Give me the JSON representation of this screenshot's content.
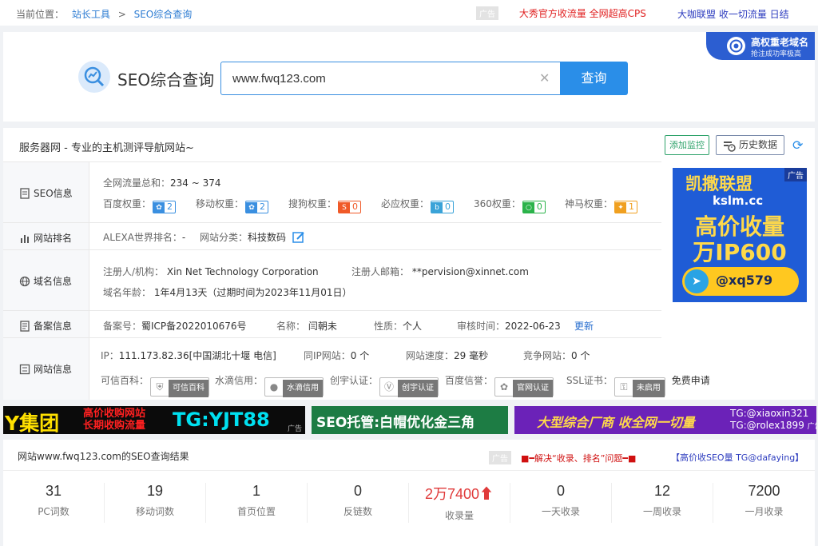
{
  "breadcrumb": {
    "prefix": "当前位置：",
    "home": "站长工具",
    "sep": ">",
    "current": "SEO综合查询"
  },
  "top_ads": {
    "ad_tag": "广告",
    "ad1": "大秀官方收流量 全网超高CPS",
    "ad2": "大咖联盟 收一切流量 日结"
  },
  "search": {
    "title": "SEO综合查询",
    "query": "www.fwq123.com",
    "button": "查询"
  },
  "corner_badge": {
    "line1": "高权重老域名",
    "line2": "抢注成功率极高"
  },
  "site": {
    "title": "服务器网 - 专业的主机测评导航网站~",
    "monitor_btn": "添加监控",
    "history_btn": "历史数据"
  },
  "seo_info": {
    "label": "SEO信息",
    "traffic_label": "全网流量总和：",
    "traffic_value": "234 ~ 374",
    "ranks": [
      {
        "label": "百度权重：",
        "value": "2",
        "color": "#3a8fe0",
        "icon": "paw-icon"
      },
      {
        "label": "移动权重：",
        "value": "2",
        "color": "#3a8fe0",
        "icon": "paw-icon"
      },
      {
        "label": "搜狗权重：",
        "value": "0",
        "color": "#f05a28",
        "icon": "sogou-icon"
      },
      {
        "label": "必应权重：",
        "value": "0",
        "color": "#3aa3d8",
        "icon": "bing-icon"
      },
      {
        "label": "360权重：",
        "value": "0",
        "color": "#2bb34a",
        "icon": "360-icon"
      },
      {
        "label": "神马权重：",
        "value": "1",
        "color": "#f0a020",
        "icon": "shenma-icon"
      }
    ]
  },
  "ranking": {
    "label": "网站排名",
    "alexa_label": "ALEXA世界排名：",
    "alexa_value": "-",
    "category_label": "网站分类：",
    "category_value": "科技数码"
  },
  "domain": {
    "label": "域名信息",
    "registrant_label": "注册人/机构：",
    "registrant_value": "Xin Net Technology Corporation",
    "email_label": "注册人邮箱：",
    "email_value": "**pervision@xinnet.com",
    "age_label": "域名年龄：",
    "age_value": "1年4月13天（过期时间为2023年11月01日）"
  },
  "icp": {
    "label": "备案信息",
    "no_label": "备案号：",
    "no_value": "蜀ICP备2022010676号",
    "name_label": "名称：",
    "name_value": "闫朝未",
    "type_label": "性质：",
    "type_value": "个人",
    "audit_label": "审核时间：",
    "audit_value": "2022-06-23",
    "update": "更新"
  },
  "site_info": {
    "label": "网站信息",
    "ip_label": "IP：",
    "ip_value": "111.173.82.36[中国湖北十堰 电信]",
    "same_ip_label": "同IP网站：",
    "same_ip_value": "0 个",
    "speed_label": "网站速度：",
    "speed_value": "29 毫秒",
    "compete_label": "竞争网站：",
    "compete_value": "0 个",
    "certs": [
      {
        "label": "可信百科：",
        "badge": "可信百科",
        "icon": "shield-icon"
      },
      {
        "label": "水滴信用：",
        "badge": "水滴信用",
        "icon": "drop-icon"
      },
      {
        "label": "创宇认证：",
        "badge": "创宇认证",
        "icon": "v-icon"
      },
      {
        "label": "百度信誉：",
        "badge": "官网认证",
        "icon": "paw-icon"
      },
      {
        "label": "SSL证书：",
        "badge": "未启用",
        "icon": "lock-icon"
      }
    ],
    "ssl_apply": "免费申请"
  },
  "side_ad": {
    "tag": "广告",
    "line1": "凯撒联盟",
    "line2": "kslm.cc",
    "line3": "高价收量",
    "line4": "万IP600",
    "handle": "@xq579"
  },
  "banners": {
    "b1_big": "Y集团",
    "b1_l1": "高价收购网站",
    "b1_l2": "长期收购流量",
    "b1_tg": "TG:YJT88",
    "b1_tag": "广告",
    "b2": "SEO托管:白帽优化金三角",
    "b3_main": "大型综合厂商 收全网一切量",
    "b3_tg1": "TG:@xiaoxin321",
    "b3_tg2": "TG:@rolex1899",
    "b3_tag": "广告"
  },
  "results": {
    "title": "网站www.fwq123.com的SEO查询结果",
    "ad_tag": "广告",
    "ad1": "■━解决“收录、排名”问题━■",
    "ad2": "【高价收SEO量 TG@dafaying】",
    "stats": [
      {
        "value": "31",
        "label": "PC词数"
      },
      {
        "value": "19",
        "label": "移动词数"
      },
      {
        "value": "1",
        "label": "首页位置"
      },
      {
        "value": "0",
        "label": "反链数"
      },
      {
        "value": "2万7400",
        "label": "收录量",
        "arrow": "⬆"
      },
      {
        "value": "0",
        "label": "一天收录"
      },
      {
        "value": "12",
        "label": "一周收录"
      },
      {
        "value": "7200",
        "label": "一月收录"
      }
    ]
  }
}
